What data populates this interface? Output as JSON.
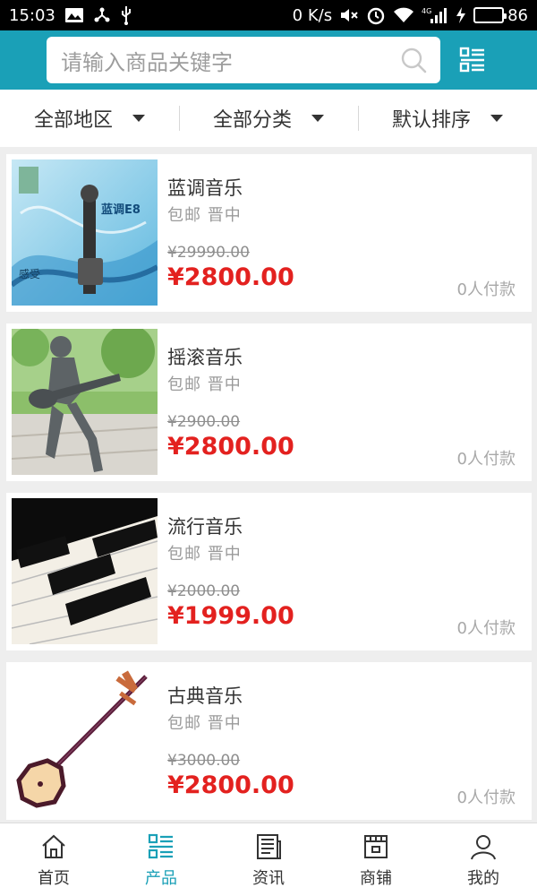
{
  "status_bar": {
    "time": "15:03",
    "network_speed": "0 K/s",
    "signal_type": "4G",
    "battery": "86",
    "battery_level": 0.86
  },
  "search": {
    "placeholder": "请输入商品关键字"
  },
  "filters": [
    {
      "label": "全部地区"
    },
    {
      "label": "全部分类"
    },
    {
      "label": "默认排序"
    }
  ],
  "products": [
    {
      "name": "蓝调音乐",
      "tags": "包邮 晋中",
      "old_price": "¥29990.00",
      "price": "¥2800.00",
      "paid": "0人付款",
      "image": "blues-album-cover",
      "cover_text": "蓝调E8",
      "cover_caption": "感受"
    },
    {
      "name": "摇滚音乐",
      "tags": "包邮 晋中",
      "old_price": "¥2900.00",
      "price": "¥2800.00",
      "paid": "0人付款",
      "image": "rock-guitarist-statue"
    },
    {
      "name": "流行音乐",
      "tags": "包邮 晋中",
      "old_price": "¥2000.00",
      "price": "¥1999.00",
      "paid": "0人付款",
      "image": "piano-keys"
    },
    {
      "name": "古典音乐",
      "tags": "包邮 晋中",
      "old_price": "¥3000.00",
      "price": "¥2800.00",
      "paid": "0人付款",
      "image": "chinese-sanxian-instrument"
    }
  ],
  "bottom_nav": [
    {
      "label": "首页",
      "icon": "home-icon",
      "active": false
    },
    {
      "label": "产品",
      "icon": "list-icon",
      "active": true
    },
    {
      "label": "资讯",
      "icon": "news-icon",
      "active": false
    },
    {
      "label": "商铺",
      "icon": "shop-icon",
      "active": false
    },
    {
      "label": "我的",
      "icon": "user-icon",
      "active": false
    }
  ],
  "colors": {
    "brand": "#1aa0b7",
    "price_red": "#e3211f",
    "background": "#eeeeee"
  }
}
